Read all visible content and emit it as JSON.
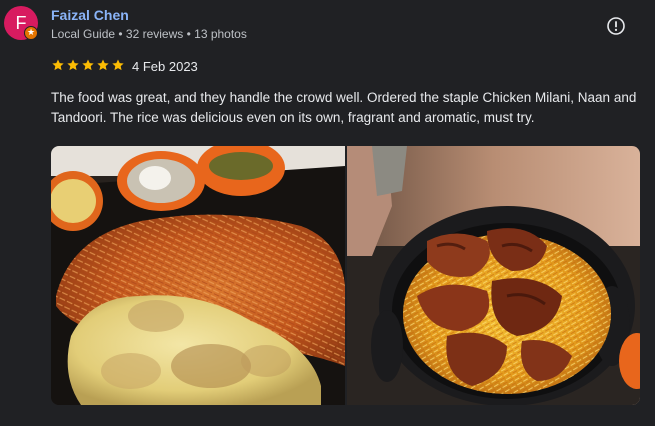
{
  "reviewer": {
    "initial": "F",
    "name": "Faizal Chen",
    "meta": "Local Guide • 32 reviews • 13 photos"
  },
  "review": {
    "rating": 5,
    "date": "4 Feb 2023",
    "text": "The food was great, and they handle the crowd well. Ordered the staple Chicken Milani, Naan and Tandoori. The rice was delicious even on its own, fragrant and aromatic, must try."
  },
  "icons": {
    "more": "exclamation-circle-icon",
    "badge": "local-guide-star-icon",
    "star": "star-icon"
  },
  "colors": {
    "background": "#202124",
    "name": "#8ab4f8",
    "star": "#fbbc04",
    "avatar": "#d81b60",
    "badge": "#e37400"
  },
  "photos": [
    {
      "name": "review-photo-chicken-milani"
    },
    {
      "name": "review-photo-tandoori-rice"
    }
  ]
}
